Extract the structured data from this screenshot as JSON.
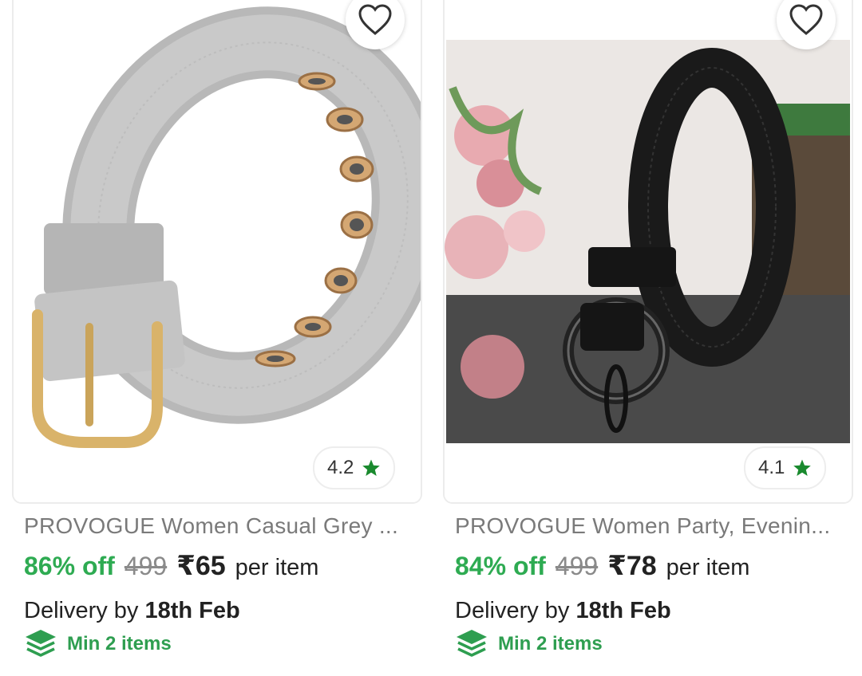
{
  "products": [
    {
      "title": "PROVOGUE Women Casual Grey ...",
      "rating": "4.2",
      "discount": "86% off",
      "mrp": "499",
      "price": "₹65",
      "unit": "per item",
      "delivery_prefix": "Delivery by",
      "delivery_date": "18th Feb",
      "min_items": "Min 2 items",
      "image_icon": "grey-fabric-belt-image"
    },
    {
      "title": "PROVOGUE Women Party, Evenin...",
      "rating": "4.1",
      "discount": "84% off",
      "mrp": "499",
      "price": "₹78",
      "unit": "per item",
      "delivery_prefix": "Delivery by",
      "delivery_date": "18th Feb",
      "min_items": "Min 2 items",
      "image_icon": "black-leather-belt-image"
    }
  ],
  "colors": {
    "discount_green": "#2eab52",
    "min_items_green": "#2e9e50",
    "star_green": "#1a8a2e"
  }
}
